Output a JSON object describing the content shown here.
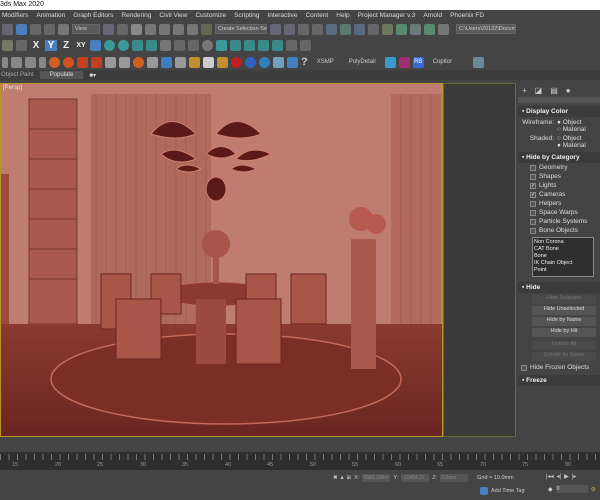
{
  "title": "3ds Max 2020",
  "menu": [
    "Modifiers",
    "Animation",
    "Graph Editors",
    "Rendering",
    "Civil View",
    "Customize",
    "Scripting",
    "Interactive",
    "Content",
    "Help",
    "Project Manager v.3",
    "Arnold",
    "Phoenix FD"
  ],
  "toolbar1": {
    "view_dropdown": "View",
    "selection_set": "Create Selection Se",
    "path": "C:\\Users\\20122\\Docum"
  },
  "toolbar2": {
    "axes": [
      "X",
      "Y",
      "Z",
      "XY"
    ]
  },
  "toolbar3": {
    "labels": [
      "XSMP",
      "PolyDetail",
      "Copitor"
    ],
    "rb": "RB",
    "help": "?"
  },
  "ribbon": {
    "object_paint": "Object Paint",
    "populate": "Populate"
  },
  "viewport": {
    "label": "[Persp]"
  },
  "command_panel": {
    "display_color": {
      "title": "Display Color",
      "wireframe": "Wireframe:",
      "shaded": "Shaded:",
      "wire_options": [
        "Object",
        "Material"
      ],
      "shaded_options": [
        "Object",
        "Material"
      ]
    },
    "hide_by_category": {
      "title": "Hide by Category",
      "items": [
        {
          "label": "Geometry",
          "checked": false
        },
        {
          "label": "Shapes",
          "checked": false
        },
        {
          "label": "Lights",
          "checked": true
        },
        {
          "label": "Cameras",
          "checked": true
        },
        {
          "label": "Helpers",
          "checked": false
        },
        {
          "label": "Space Warps",
          "checked": false
        },
        {
          "label": "Particle Systems",
          "checked": false
        },
        {
          "label": "Bone Objects",
          "checked": false
        }
      ],
      "list": [
        "Non Corona",
        "CAT Bone",
        "Bone",
        "IK Chain Object",
        "Point"
      ]
    },
    "hide": {
      "title": "Hide",
      "buttons": [
        "Hide Selected",
        "Hide Unselected",
        "Hide by Name",
        "Hide by Hit",
        "Unhide All",
        "Unhide by Name"
      ],
      "hide_frozen": "Hide Frozen Objects"
    },
    "freeze": {
      "title": "Freeze"
    }
  },
  "timeline": {
    "ticks": [
      "15",
      "20",
      "25",
      "30",
      "35",
      "40",
      "45",
      "50",
      "55",
      "60",
      "65",
      "70",
      "75",
      "80"
    ]
  },
  "status": {
    "x_label": "X:",
    "x": "6583.109m",
    "y_label": "Y:",
    "y": "-10484.27",
    "z_label": "Z:",
    "z": "0.0mm",
    "grid": "Grid = 10.0mm",
    "add_time_tag": "Add Time Tag",
    "frame": "0"
  }
}
